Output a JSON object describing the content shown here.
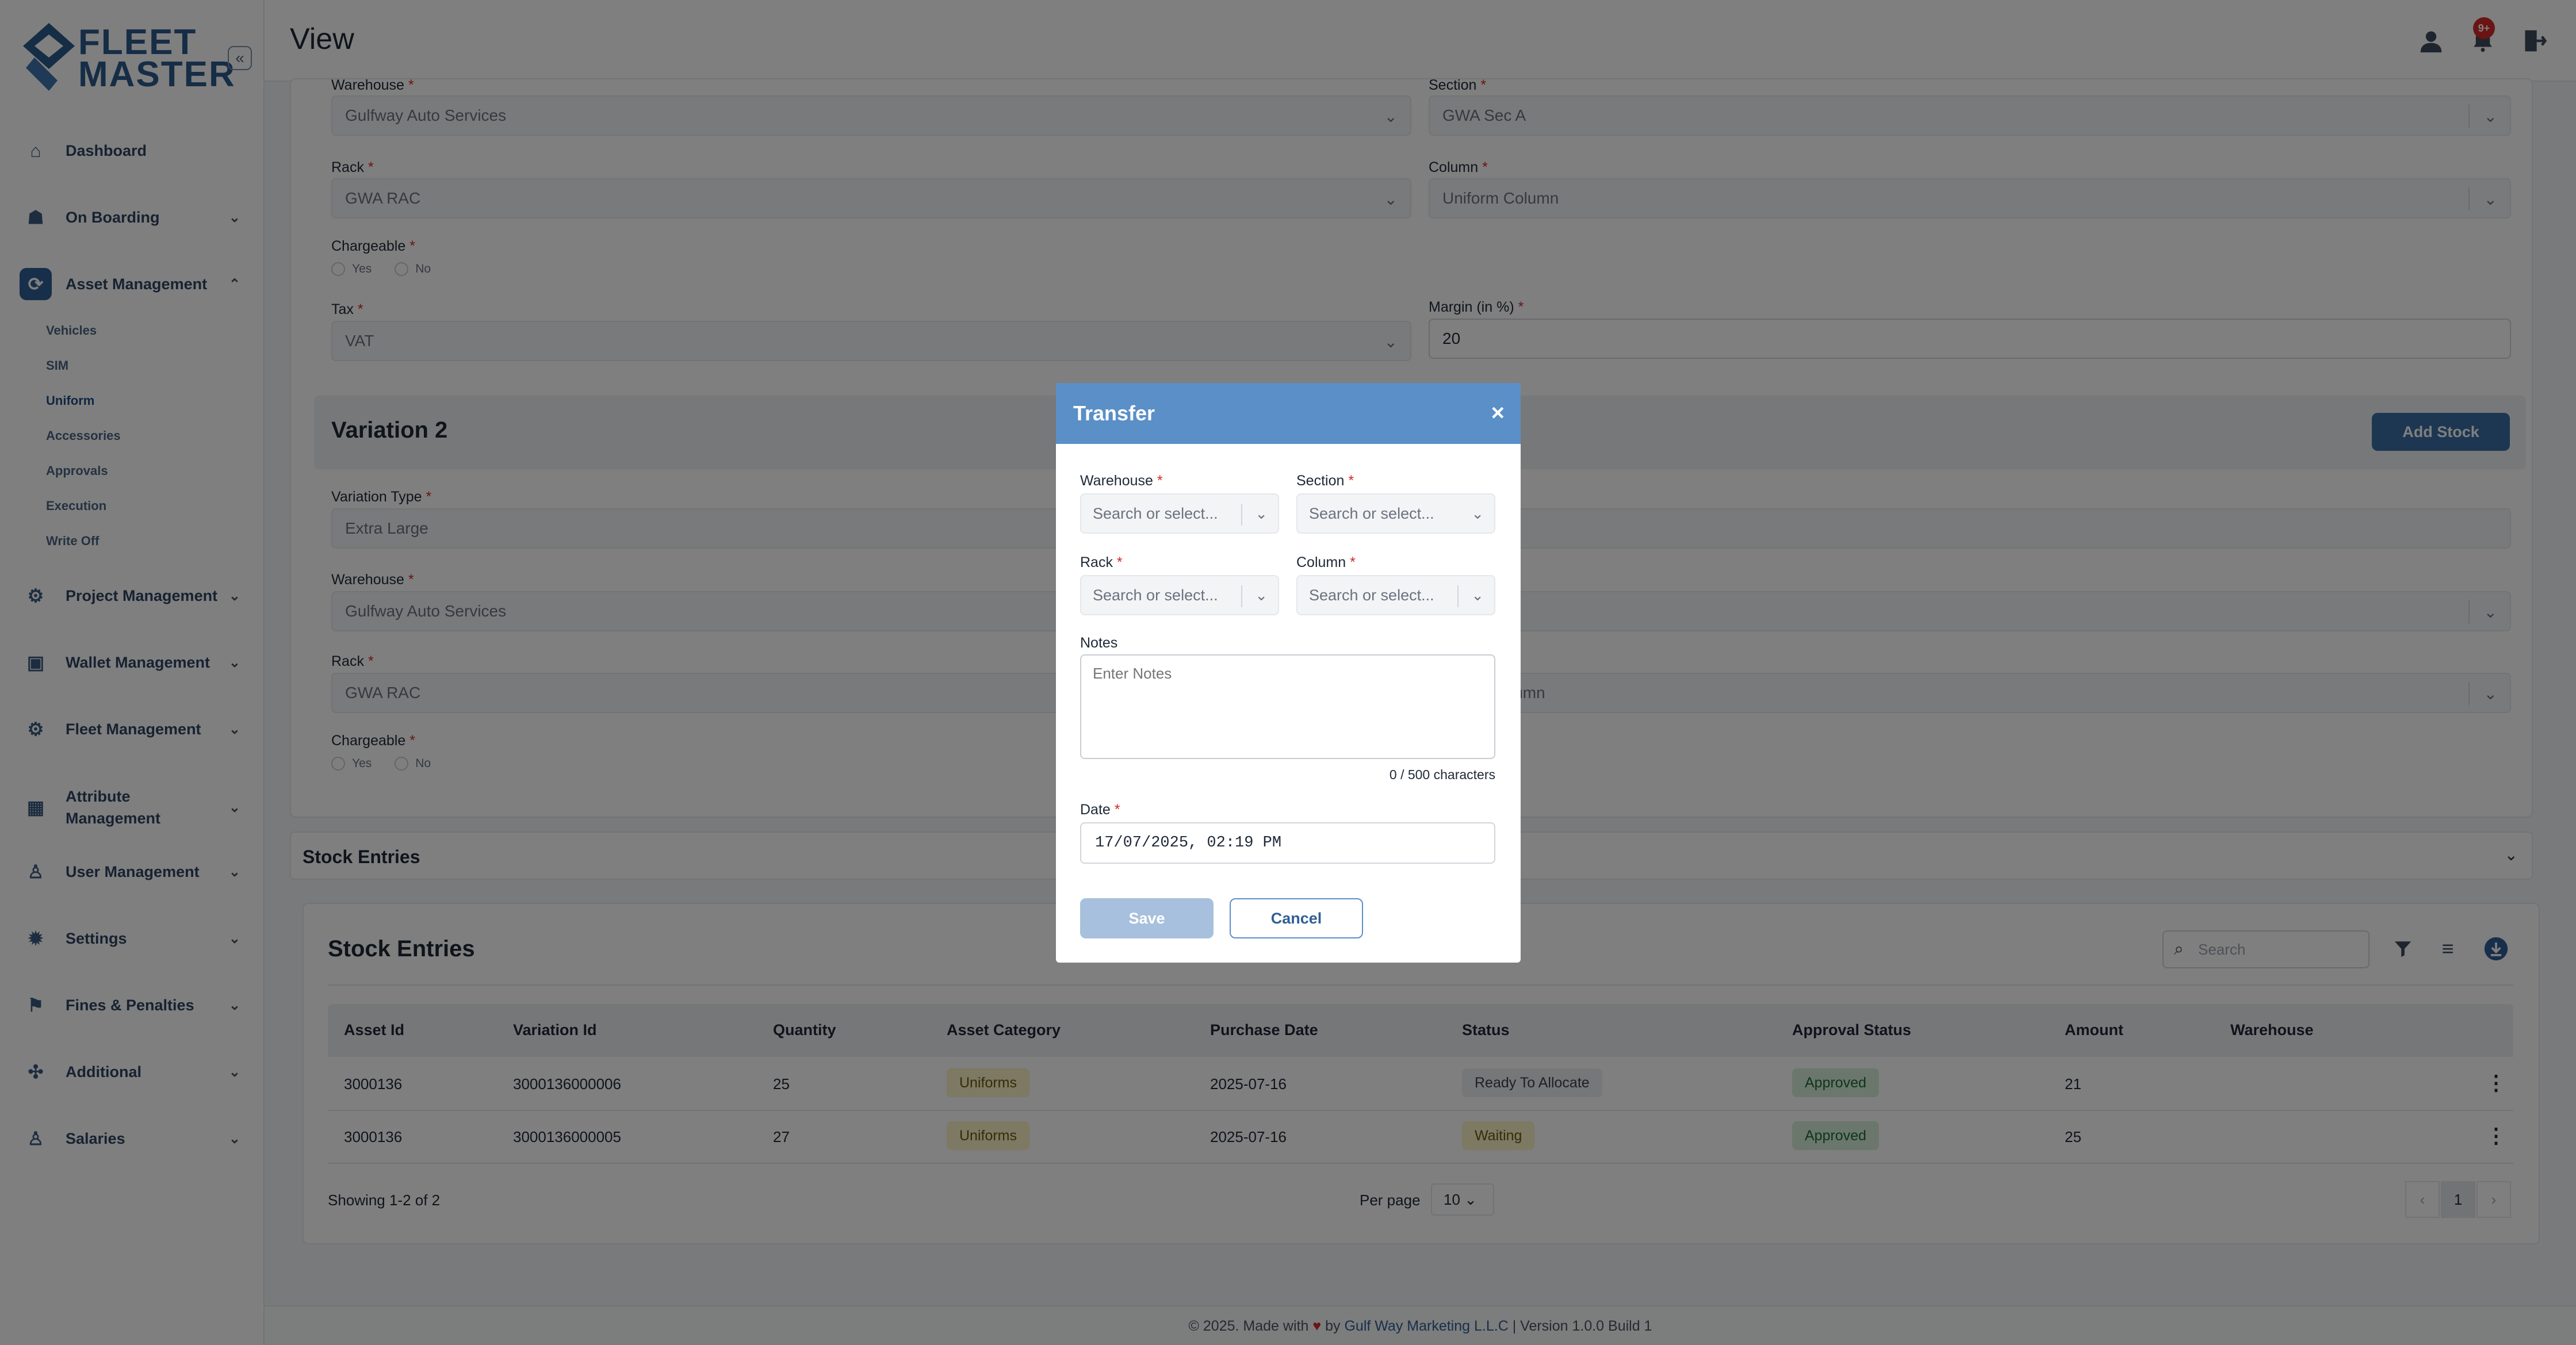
{
  "brand": {
    "logo_line1": "FLEET",
    "logo_line2": "MASTER"
  },
  "header": {
    "title": "View",
    "notif_count": "9+"
  },
  "sidebar": {
    "items": [
      {
        "label": "Dashboard",
        "icon": "home-icon"
      },
      {
        "label": "On Boarding",
        "icon": "onboarding-icon"
      },
      {
        "label": "Asset Management",
        "icon": "asset-icon"
      },
      {
        "label": "Project Management",
        "icon": "project-icon"
      },
      {
        "label": "Wallet Management",
        "icon": "wallet-icon"
      },
      {
        "label": "Fleet Management",
        "icon": "fleet-icon"
      },
      {
        "label": "Attribute Management",
        "icon": "attribute-icon"
      },
      {
        "label": "User Management",
        "icon": "users-icon"
      },
      {
        "label": "Settings",
        "icon": "gear-icon"
      },
      {
        "label": "Fines & Penalties",
        "icon": "fines-icon"
      },
      {
        "label": "Additional",
        "icon": "additional-icon"
      },
      {
        "label": "Salaries",
        "icon": "salaries-icon"
      }
    ],
    "subitems": [
      "Vehicles",
      "SIM",
      "Uniform",
      "Accessories",
      "Approvals",
      "Execution",
      "Write Off"
    ]
  },
  "form": {
    "warehouse_label": "Warehouse",
    "warehouse_value": "Gulfway Auto Services",
    "section_label": "Section",
    "section_value": "GWA Sec A",
    "rack_label": "Rack",
    "rack_value": "GWA RAC",
    "column_label": "Column",
    "column_value": "Uniform Column",
    "chargeable_label": "Chargeable",
    "yes_label": "Yes",
    "no_label": "No",
    "tax_label": "Tax",
    "tax_value": "VAT",
    "margin_label": "Margin (in %)",
    "margin_value": "20",
    "variation_title": "Variation 2",
    "add_stock": "Add Stock",
    "variation_type_label": "Variation Type",
    "variation_type_value": "Extra Large",
    "column_value_partial": "lumn",
    "required_mark": "*"
  },
  "stock_entries": {
    "section_title": "Stock Entries",
    "card_title": "Stock Entries",
    "search_placeholder": "Search",
    "columns": [
      "Asset Id",
      "Variation Id",
      "Quantity",
      "Asset Category",
      "Purchase Date",
      "Status",
      "Approval Status",
      "Amount",
      "Warehouse"
    ],
    "rows": [
      {
        "asset_id": "3000136",
        "variation_id": "3000136000006",
        "quantity": "25",
        "category": "Uniforms",
        "purchase_date": "2025-07-16",
        "status": "Ready To Allocate",
        "approval": "Approved",
        "amount": "21",
        "warehouse": ""
      },
      {
        "asset_id": "3000136",
        "variation_id": "3000136000005",
        "quantity": "27",
        "category": "Uniforms",
        "purchase_date": "2025-07-16",
        "status": "Waiting",
        "approval": "Approved",
        "amount": "25",
        "warehouse": ""
      }
    ],
    "showing": "Showing 1-2 of 2",
    "per_page_label": "Per page",
    "per_page_value": "10",
    "current_page": "1"
  },
  "footer": {
    "prefix": "© 2025. Made with",
    "by": "by",
    "company": "Gulf Way Marketing L.L.C",
    "version": "| Version 1.0.0 Build 1"
  },
  "modal": {
    "title": "Transfer",
    "warehouse_label": "Warehouse",
    "section_label": "Section",
    "rack_label": "Rack",
    "column_label": "Column",
    "select_placeholder": "Search or select...",
    "notes_label": "Notes",
    "notes_placeholder": "Enter Notes",
    "char_count": "0 / 500 characters",
    "date_label": "Date",
    "date_value": "17/07/2025, 02:19 PM",
    "save": "Save",
    "cancel": "Cancel"
  },
  "colors": {
    "brand": "#2f5f95",
    "modal_header": "#5a8fc7",
    "danger": "#d62828"
  }
}
